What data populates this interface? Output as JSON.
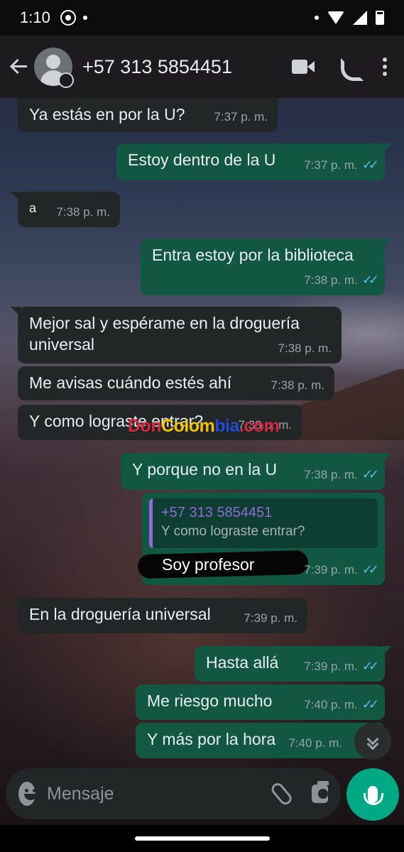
{
  "status_bar": {
    "time": "1:10",
    "icons": [
      "whatsapp-icon",
      "notification-dot",
      "wifi-icon",
      "signal-icon",
      "battery-icon"
    ]
  },
  "header": {
    "contact_name": "+57 313 5854451",
    "icons": [
      "back-arrow-icon",
      "avatar",
      "video-call-icon",
      "voice-call-icon",
      "more-options-icon"
    ]
  },
  "messages": [
    {
      "direction": "in",
      "text": "Ya estás en por la U?",
      "time": "7:37 p. m."
    },
    {
      "direction": "out",
      "text": "Estoy dentro de la U",
      "time": "7:37 p. m.",
      "read": true
    },
    {
      "direction": "in",
      "text": "a",
      "time": "7:38 p. m."
    },
    {
      "direction": "out",
      "text": "Entra estoy por la biblioteca",
      "time": "7:38 p. m.",
      "read": true
    },
    {
      "direction": "in",
      "text": "Mejor sal y espérame en la droguería universal",
      "time": "7:38 p. m."
    },
    {
      "direction": "in",
      "text": "Me avisas cuándo estés ahí",
      "time": "7:38 p. m."
    },
    {
      "direction": "in",
      "text": "Y como lograste entrar?",
      "time": "7:38 p. m."
    },
    {
      "direction": "out",
      "text": "Y porque no en la U",
      "time": "7:38 p. m.",
      "read": true
    },
    {
      "direction": "out",
      "reply_to": {
        "name": "+57 313 5854451",
        "text": "Y como lograste entrar?"
      },
      "text": "Soy profesor",
      "time": "7:39 p. m.",
      "read": true
    },
    {
      "direction": "in",
      "text": "En la droguería universal",
      "time": "7:39 p. m."
    },
    {
      "direction": "out",
      "text": "Hasta allá",
      "time": "7:39 p. m.",
      "read": true
    },
    {
      "direction": "out",
      "text": "Me riesgo mucho",
      "time": "7:40 p. m.",
      "read": true
    },
    {
      "direction": "out",
      "text": "Y más por la hora",
      "time": "7:40 p. m.",
      "read": false
    }
  ],
  "ticks": "✓✓",
  "watermark": {
    "p1": "Don",
    "p2": "Colom",
    "p3": "bia",
    "p4": ".com"
  },
  "composer": {
    "placeholder": "Mensaje"
  },
  "colors": {
    "incoming_bubble": "#232627",
    "outgoing_bubble": "#115741",
    "read_ticks": "#53bdeb",
    "mic_button": "#00a884"
  }
}
